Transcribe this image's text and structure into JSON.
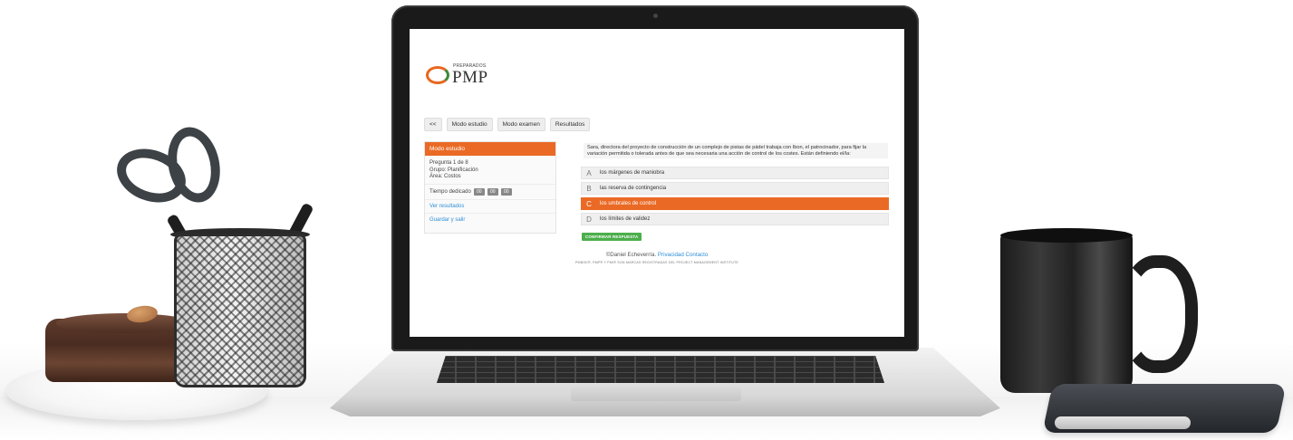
{
  "logo": {
    "small_text": "PREPARADOS",
    "big_text": "PMP"
  },
  "tabs": [
    {
      "label": "<<"
    },
    {
      "label": "Modo estudio"
    },
    {
      "label": "Modo examen"
    },
    {
      "label": "Resultados"
    }
  ],
  "panel": {
    "title": "Modo estudio",
    "question_counter": "Pregunta 1 de 8",
    "group": "Grupo: Planificación",
    "area": "Área: Costos",
    "time_label": "Tiempo dedicado",
    "time": [
      "00",
      "00",
      "00"
    ],
    "links": [
      "Ver resultados",
      "Guardar y salir"
    ]
  },
  "question": {
    "text": "Sara, directora del proyecto de construcción de un complejo de pistas de pádel trabaja con Ibon, el patrocinador, para fijar la variación permitida o tolerada antes de que sea necesaria una acción de control de los costes. Están definiendo el/la:",
    "options": [
      {
        "letter": "A",
        "text": "los márgenes de maniobra",
        "selected": false
      },
      {
        "letter": "B",
        "text": "las reserva de contingencia",
        "selected": false
      },
      {
        "letter": "C",
        "text": "los umbrales de control",
        "selected": true
      },
      {
        "letter": "D",
        "text": "los límites de validez",
        "selected": false
      }
    ],
    "confirm_label": "CONFIRMAR RESPUESTA"
  },
  "footer": {
    "copyright": "©Daniel Echeverría.",
    "privacy_link": "Privacidad Contacto",
    "note": "PMBOK®, PMP® Y PMI® SON MARCAS REGISTRADAS DEL PROJECT MANAGEMENT INSTITUTE"
  },
  "colors": {
    "accent": "#ea6a25",
    "link": "#2f8fd8",
    "confirm": "#4cae4c"
  }
}
